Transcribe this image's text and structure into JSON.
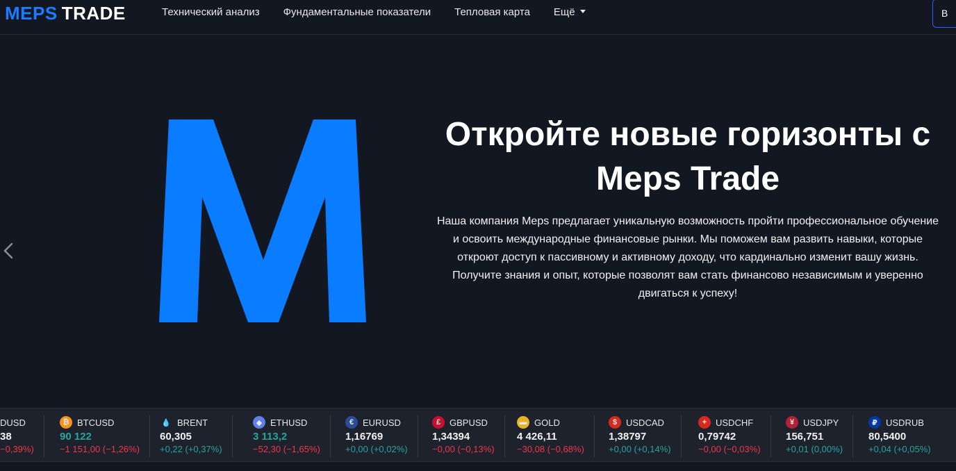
{
  "header": {
    "logo_part1": "MEPS",
    "logo_part2": "TRADE",
    "nav": [
      "Технический анализ",
      "Фундаментальные показатели",
      "Тепловая карта",
      "Ещё"
    ],
    "button_label": "В"
  },
  "hero": {
    "title_line1": "Откройте новые горизонты с",
    "title_line2": "Meps Trade",
    "text_lines": [
      "Наша компания Meps предлагает уникальную возможность пройти профессиональное обучение",
      "и освоить международные финансовые рынки. Мы поможем вам развить навыки, которые",
      "откроют доступ к пассивному и активному доходу, что кардинально изменит вашу жизнь.",
      "Получите знания и опыт, которые позволят вам стать финансово независимым и уверенно",
      "двигаться к успеху!"
    ],
    "accent_color": "#0a7cff"
  },
  "ticker": [
    {
      "symbol": "DUSD",
      "price": "38",
      "change": "−0,39%)",
      "price_dir": "neutral",
      "dir": "down",
      "icon": "none"
    },
    {
      "symbol": "BTCUSD",
      "price": "90 122",
      "change": "−1 151,00 (−1,26%)",
      "price_dir": "up",
      "dir": "down",
      "icon": "bitcoin-icon",
      "icon_color": "#f7931a",
      "icon_glyph": "₿"
    },
    {
      "symbol": "BRENT",
      "price": "60,305",
      "change": "+0,22 (+0,37%)",
      "price_dir": "neutral",
      "dir": "up",
      "icon": "oil-drop-icon",
      "icon_color": "#1e222d",
      "icon_glyph": "💧"
    },
    {
      "symbol": "ETHUSD",
      "price": "3 113,2",
      "change": "−52,30 (−1,65%)",
      "price_dir": "up",
      "dir": "down",
      "icon": "ethereum-icon",
      "icon_color": "#627eea",
      "icon_glyph": "◆"
    },
    {
      "symbol": "EURUSD",
      "price": "1,16769",
      "change": "+0,00 (+0,02%)",
      "price_dir": "neutral",
      "dir": "up",
      "icon": "eu-us-flag-icon",
      "icon_color": "#2a4d9b",
      "icon_glyph": "€"
    },
    {
      "symbol": "GBPUSD",
      "price": "1,34394",
      "change": "−0,00 (−0,13%)",
      "price_dir": "neutral",
      "dir": "down",
      "icon": "uk-us-flag-icon",
      "icon_color": "#c8102e",
      "icon_glyph": "£"
    },
    {
      "symbol": "GOLD",
      "price": "4 426,11",
      "change": "−30,08 (−0,68%)",
      "price_dir": "neutral",
      "dir": "down",
      "icon": "gold-icon",
      "icon_color": "#e6b325",
      "icon_glyph": "▬"
    },
    {
      "symbol": "USDCAD",
      "price": "1,38797",
      "change": "+0,00 (+0,14%)",
      "price_dir": "neutral",
      "dir": "up",
      "icon": "us-ca-flag-icon",
      "icon_color": "#d52b1e",
      "icon_glyph": "$"
    },
    {
      "symbol": "USDCHF",
      "price": "0,79742",
      "change": "−0,00 (−0,03%)",
      "price_dir": "neutral",
      "dir": "down",
      "icon": "us-ch-flag-icon",
      "icon_color": "#d52b1e",
      "icon_glyph": "+"
    },
    {
      "symbol": "USDJPY",
      "price": "156,751",
      "change": "+0,01 (0,00%)",
      "price_dir": "neutral",
      "dir": "up",
      "icon": "us-jp-flag-icon",
      "icon_color": "#b22234",
      "icon_glyph": "¥"
    },
    {
      "symbol": "USDRUB",
      "price": "80,5400",
      "change": "+0,04 (+0,05%)",
      "price_dir": "neutral",
      "dir": "up",
      "icon": "us-ru-flag-icon",
      "icon_color": "#0039a6",
      "icon_glyph": "₽"
    }
  ]
}
